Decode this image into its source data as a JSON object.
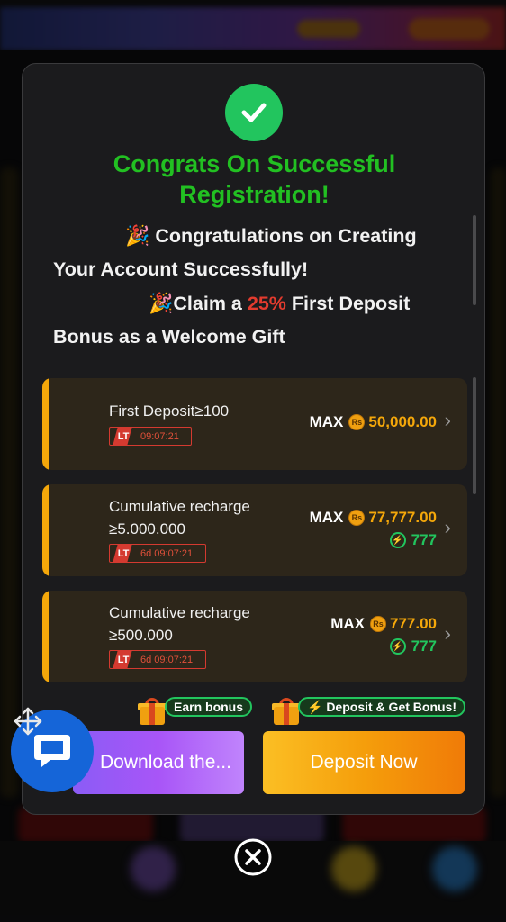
{
  "modal": {
    "title_line1": "Congrats On Successful",
    "title_line2": "Registration!",
    "message": {
      "line1": "Congratulations on Creating",
      "line2": "Your Account Successfully!",
      "line3_prefix": "Claim a ",
      "line3_pct": "25%",
      "line3_suffix": " First Deposit",
      "line4": "Bonus as a Welcome Gift"
    },
    "emoji": "🎉"
  },
  "offers": [
    {
      "condition_line1": "First Deposit≥100",
      "condition_line2": "",
      "timer_label": "LT",
      "timer": "09:07:21",
      "max_label": "MAX",
      "currency": "Rs",
      "amount": "50,000.00",
      "bonus": ""
    },
    {
      "condition_line1": "Cumulative recharge",
      "condition_line2": "≥5.000.000",
      "timer_label": "LT",
      "timer": "6d 09:07:21",
      "max_label": "MAX",
      "currency": "Rs",
      "amount": "77,777.00",
      "bonus": "777"
    },
    {
      "condition_line1": "Cumulative recharge",
      "condition_line2": "≥500.000",
      "timer_label": "LT",
      "timer": "6d 09:07:21",
      "max_label": "MAX",
      "currency": "Rs",
      "amount": "777.00",
      "bonus": "777"
    }
  ],
  "actions": {
    "download_label": "Download the...",
    "download_tag": "Earn bonus",
    "deposit_label": "Deposit Now",
    "deposit_tag": "⚡ Deposit & Get Bonus!"
  },
  "colors": {
    "title_green": "#22c022",
    "accent_orange": "#f4a70a",
    "bonus_green": "#22c55e",
    "percent_red": "#e23b2e",
    "chat_blue": "#1565d8"
  },
  "icons": [
    "check-icon",
    "party-popper-icon",
    "coin-icon",
    "bolt-icon",
    "chevron-right-icon",
    "gift-icon",
    "chat-icon",
    "move-icon",
    "close-icon"
  ]
}
